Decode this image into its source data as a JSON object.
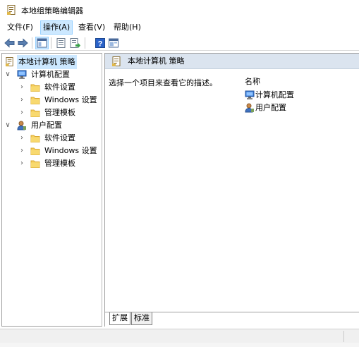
{
  "window": {
    "title": "本地组策略编辑器",
    "icon": "policy-document-icon"
  },
  "menubar": {
    "items": [
      {
        "label": "文件(F)"
      },
      {
        "label": "操作(A)"
      },
      {
        "label": "查看(V)"
      },
      {
        "label": "帮助(H)"
      }
    ]
  },
  "toolbar": {
    "buttons": [
      "back-arrow-icon",
      "forward-arrow-icon",
      "show-hide-tree-icon",
      "properties-icon",
      "export-list-icon",
      "help-icon",
      "extended-view-icon"
    ]
  },
  "tree": {
    "root": "本地计算机 策略",
    "computer": "计算机配置",
    "computer_children": [
      "软件设置",
      "Windows 设置",
      "管理模板"
    ],
    "user": "用户配置",
    "user_children": [
      "软件设置",
      "Windows 设置",
      "管理模板"
    ]
  },
  "details": {
    "header": "本地计算机 策略",
    "description": "选择一个项目来查看它的描述。",
    "column_name": "名称",
    "items": [
      "计算机配置",
      "用户配置"
    ]
  },
  "tabs": [
    "扩展",
    "标准"
  ],
  "colors": {
    "selection": "#cce8ff",
    "header_bg": "#dbe4ef",
    "folder": "#f5cf5f"
  }
}
